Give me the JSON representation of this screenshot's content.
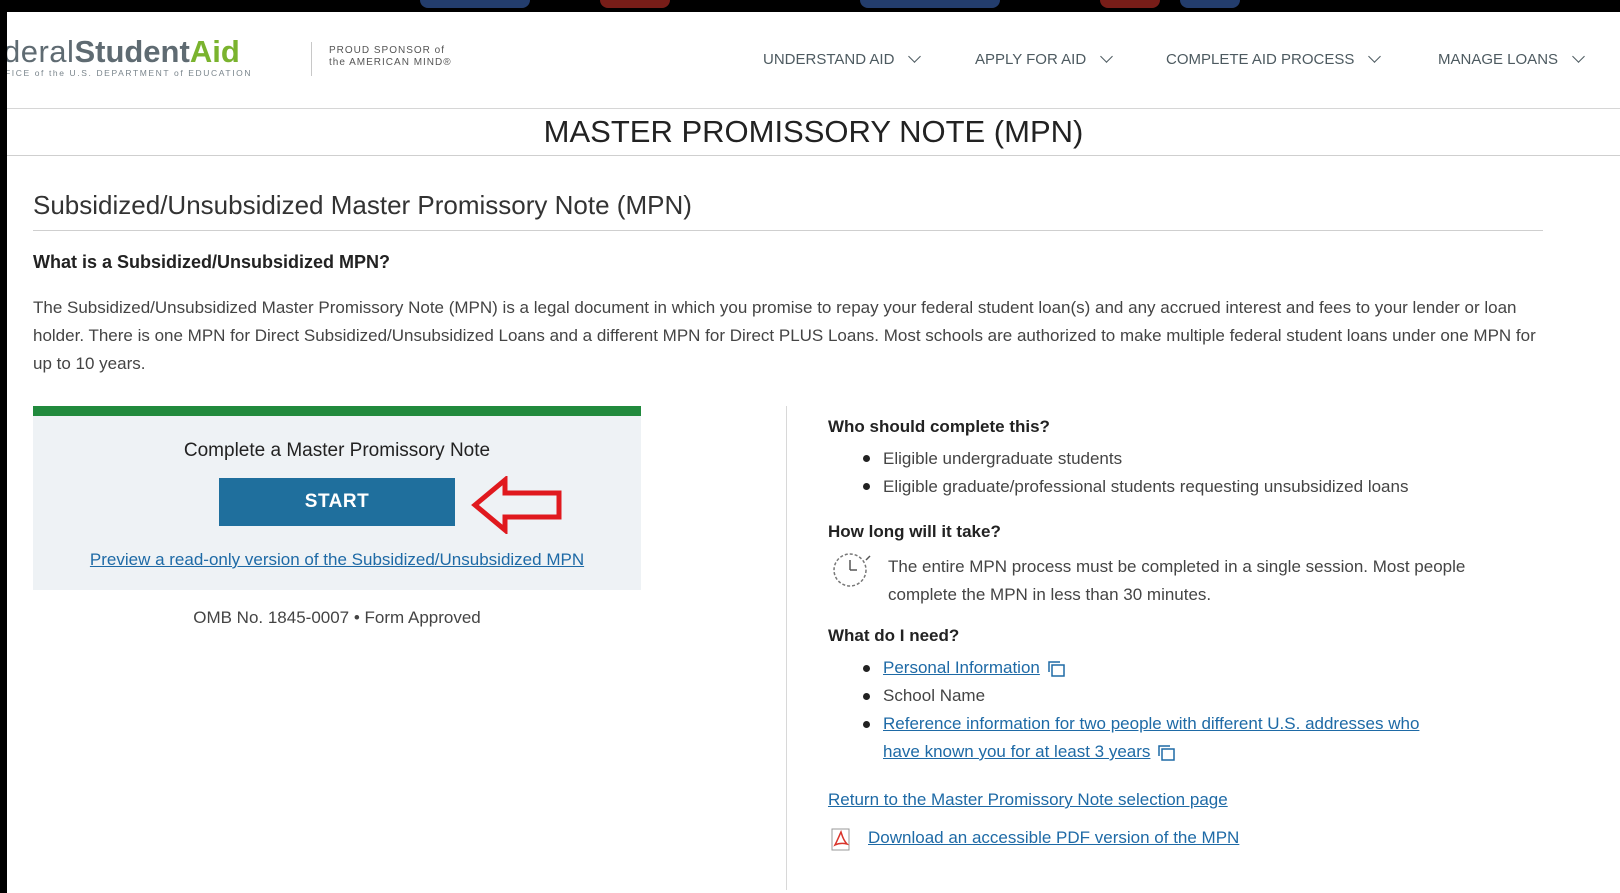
{
  "header": {
    "logo_word1": "deral",
    "logo_word2": "Student",
    "logo_word3": "Aid",
    "logo_sub": "FICE of the U.S. DEPARTMENT of EDUCATION",
    "sponsor_line1": "PROUD SPONSOR of",
    "sponsor_line2": "the AMERICAN MIND®",
    "nav": [
      {
        "label": "UNDERSTAND AID"
      },
      {
        "label": "APPLY FOR AID"
      },
      {
        "label": "COMPLETE AID PROCESS"
      },
      {
        "label": "MANAGE LOANS"
      }
    ]
  },
  "page_title": "MASTER PROMISSORY NOTE (MPN)",
  "section": {
    "title": "Subsidized/Unsubsidized Master Promissory Note (MPN)",
    "question": "What is a Subsidized/Unsubsidized MPN?",
    "description": "The Subsidized/Unsubsidized Master Promissory Note (MPN) is a legal document in which you promise to repay your federal student loan(s) and any accrued interest and fees to your lender or loan holder. There is one MPN for Direct Subsidized/Unsubsidized Loans and a different MPN for Direct PLUS Loans. Most schools are authorized to make multiple federal student loans under one MPN for up to 10 years."
  },
  "card": {
    "title": "Complete a Master Promissory Note",
    "start_label": "START",
    "preview_link": "Preview a read-only version of the Subsidized/Unsubsidized MPN",
    "omb": "OMB No. 1845-0007 • Form Approved",
    "accent_color": "#218a3d",
    "button_color": "#1f6f9d"
  },
  "sidebar": {
    "who_heading": "Who should complete this?",
    "who_items": [
      "Eligible undergraduate students",
      "Eligible graduate/professional students requesting unsubsidized loans"
    ],
    "time_heading": "How long will it take?",
    "time_text": "The entire MPN process must be completed in a single session. Most people complete the MPN in less than 30 minutes.",
    "need_heading": "What do I need?",
    "need_item1": "Personal Information",
    "need_item2": "School Name",
    "need_item3_line1": "Reference information for two people with different U.S. addresses who",
    "need_item3_line2": "have known you for at least 3 years",
    "return_link": "Return to the Master Promissory Note selection page",
    "pdf_link": "Download an accessible PDF version of the MPN"
  }
}
